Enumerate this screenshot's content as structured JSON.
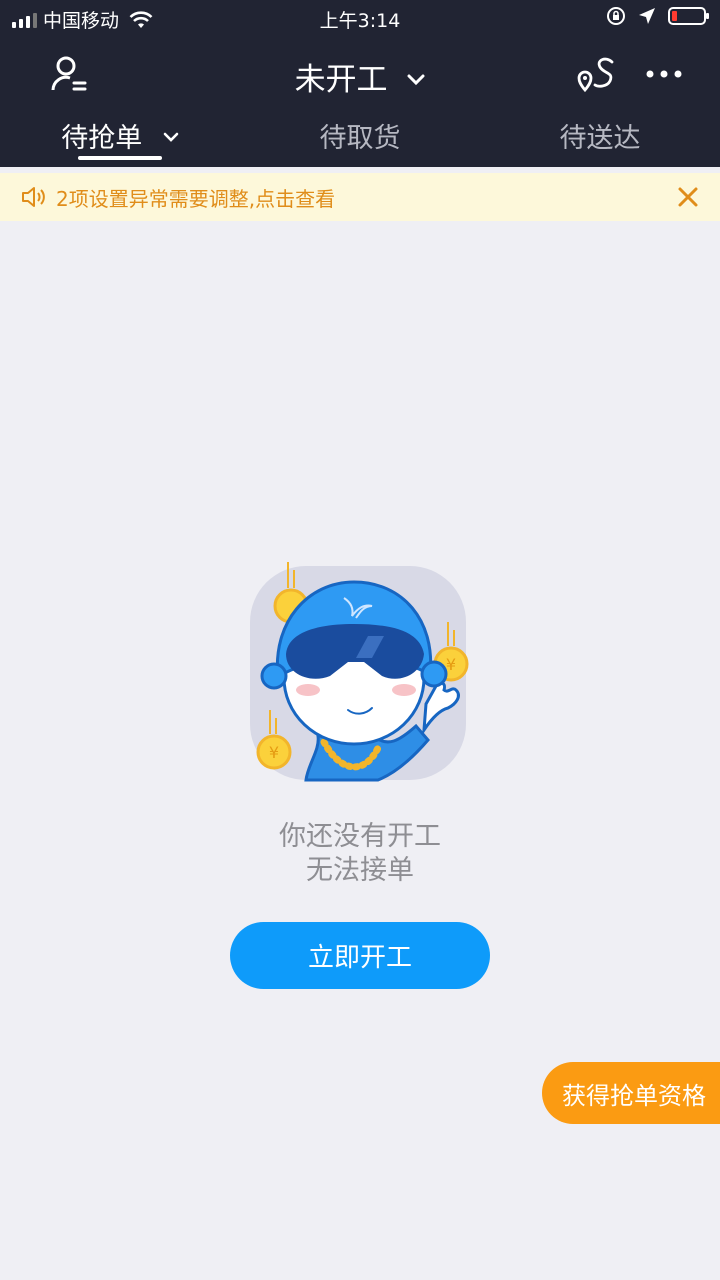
{
  "status_bar": {
    "carrier": "中国移动",
    "time": "上午3:14"
  },
  "nav": {
    "title": "未开工",
    "title_chevron": "⌄"
  },
  "tabs": [
    {
      "label": "待抢单",
      "active": true
    },
    {
      "label": "待取货",
      "active": false
    },
    {
      "label": "待送达",
      "active": false
    }
  ],
  "notice": {
    "text": "2项设置异常需要调整,点击查看"
  },
  "empty_state": {
    "line1": "你还没有开工",
    "line2": "无法接单",
    "button": "立即开工"
  },
  "float_button": {
    "label": "获得抢单资格"
  },
  "colors": {
    "topbar": "#212433",
    "accent_blue": "#0e9bfa",
    "notice_bg": "#fdf8da",
    "notice_text": "#e08d1a",
    "float_orange": "#fb9b12",
    "page_bg": "#efeff4"
  },
  "icons": [
    "profile-menu-icon",
    "route-map-icon",
    "more-icon",
    "speaker-icon",
    "close-icon",
    "wifi-icon",
    "location-arrow-icon",
    "rotation-lock-icon",
    "battery-icon"
  ]
}
